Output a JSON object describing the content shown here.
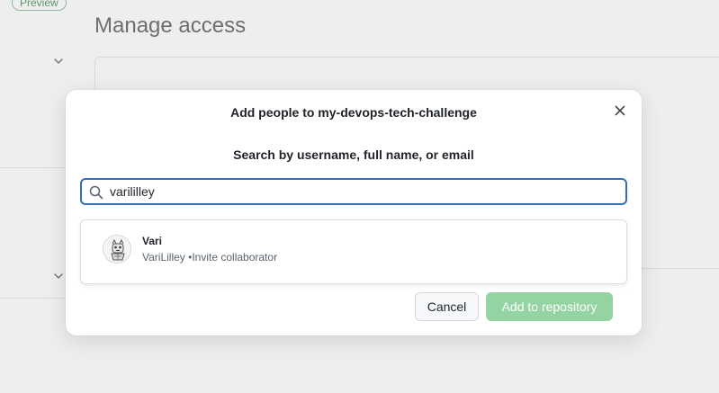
{
  "background": {
    "badge": "Preview",
    "title": "Manage access"
  },
  "modal": {
    "title": "Add people to my-devops-tech-challenge",
    "close_icon": "close-icon",
    "search_label": "Search by username, full name, or email",
    "search_value": "varililley",
    "results": [
      {
        "name": "Vari",
        "username": "VariLilley",
        "action": "Invite collaborator"
      }
    ],
    "cancel_label": "Cancel",
    "add_label": "Add to repository"
  },
  "colors": {
    "focus_border": "#2f6fb6",
    "primary_disabled": "#94d3a2",
    "badge_green": "#5a9568"
  }
}
